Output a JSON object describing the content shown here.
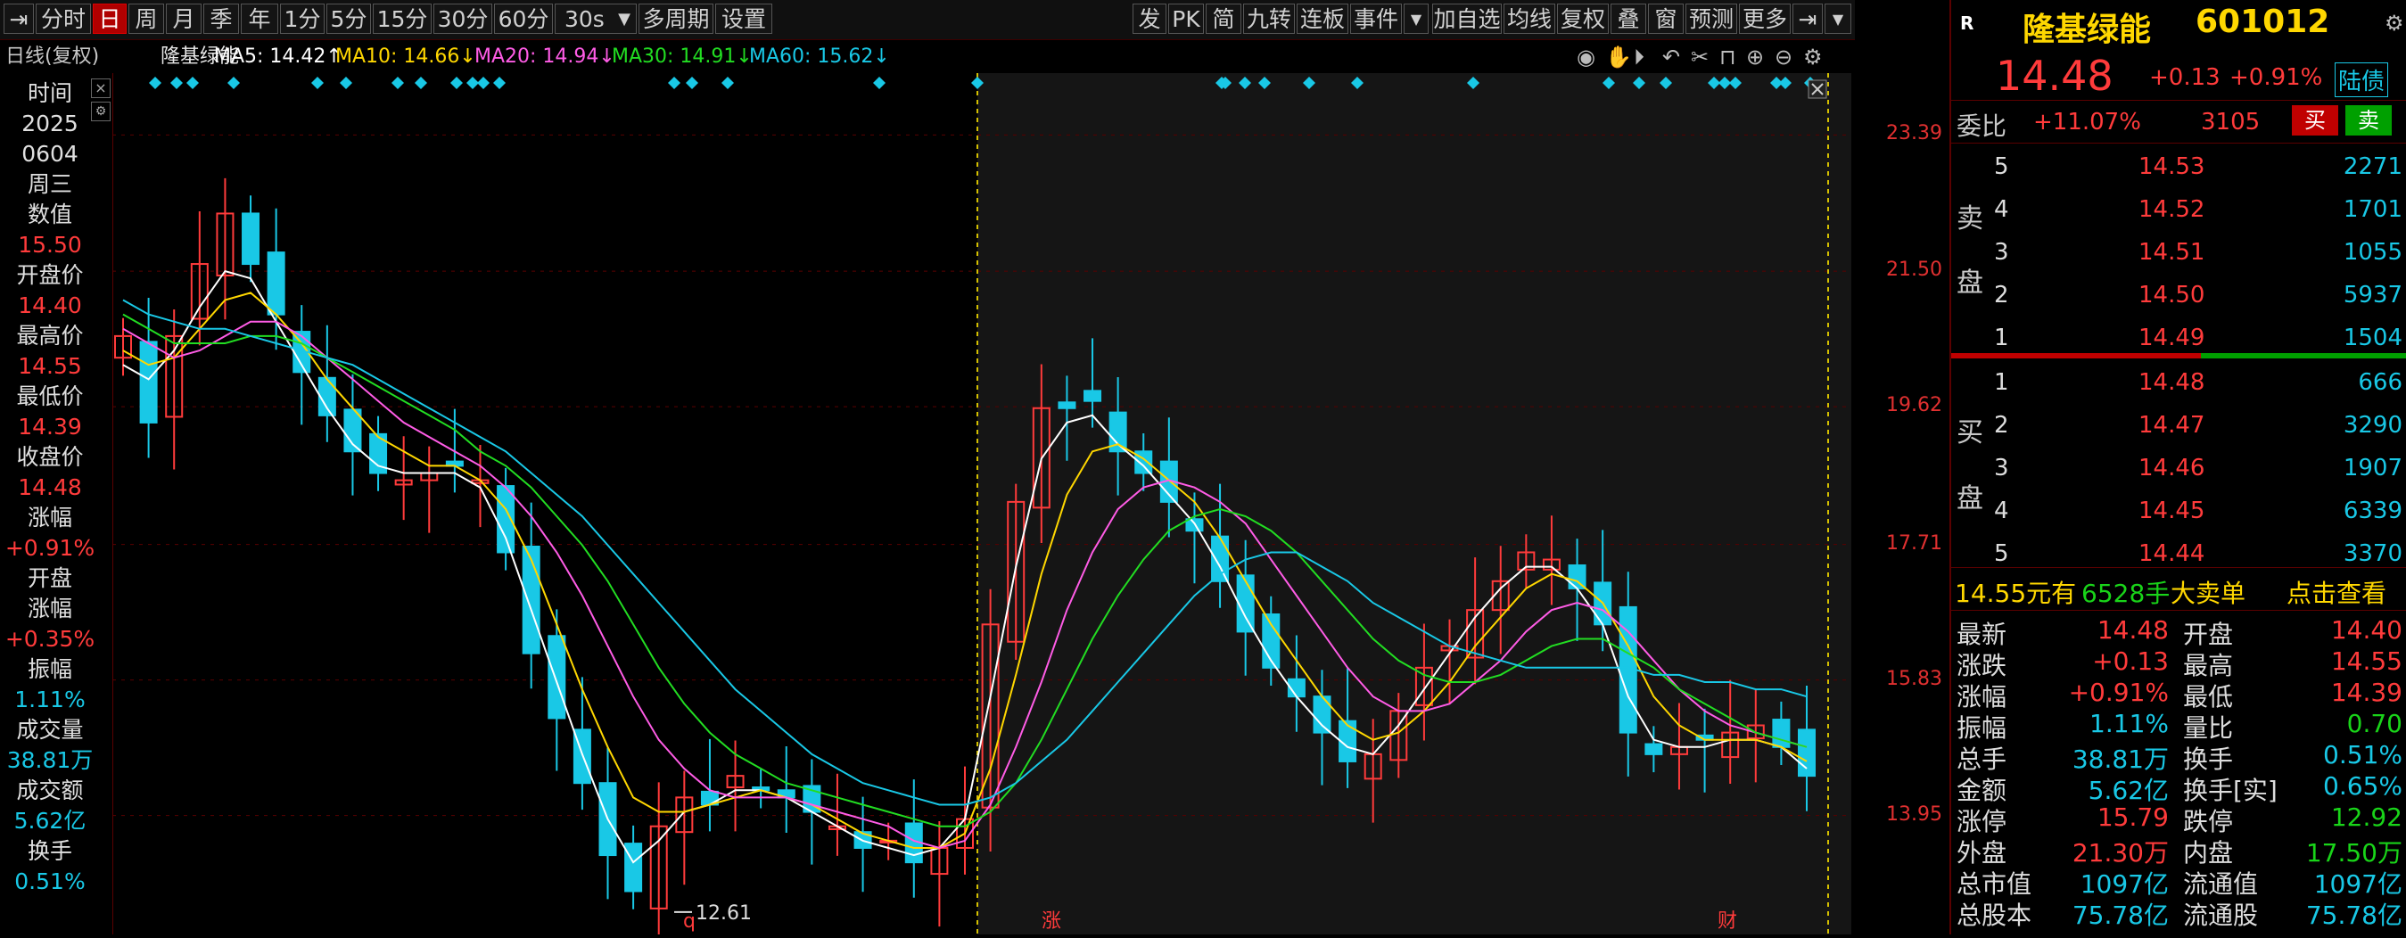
{
  "toolbar": {
    "left": [
      "分时",
      "日",
      "周",
      "月",
      "季",
      "年",
      "1分",
      "5分",
      "15分",
      "30分",
      "60分",
      "30s",
      "多周期",
      "设置"
    ],
    "right": [
      "发",
      "PK",
      "简",
      "九转",
      "连板",
      "事件",
      "加自选",
      "均线",
      "复权",
      "叠",
      "窗",
      "预测",
      "更多"
    ]
  },
  "ma_bar": {
    "mode": "日线(复权)",
    "name": "隆基绿能",
    "ma5": "MA5: 14.42↑",
    "ma10": "MA10: 14.66↓",
    "ma20": "MA20: 14.94↓",
    "ma30": "MA30: 14.91↓",
    "ma60": "MA60: 15.62↓"
  },
  "left_panel": {
    "time_label": "时间",
    "year": "2025",
    "date": "0604",
    "weekday": "周三",
    "value_label": "数值",
    "value": "15.50",
    "open_label": "开盘价",
    "open": "14.40",
    "high_label": "最高价",
    "high": "14.55",
    "low_label": "最低价",
    "low": "14.39",
    "close_label": "收盘价",
    "close": "14.48",
    "chg_label": "涨幅",
    "chg": "+0.91%",
    "openchg_label1": "开盘",
    "openchg_label2": "涨幅",
    "openchg": "+0.35%",
    "amp_label": "振幅",
    "amp": "1.11%",
    "vol_label": "成交量",
    "vol": "38.81万",
    "amt_label": "成交额",
    "amt": "5.62亿",
    "turn_label": "换手",
    "turn": "0.51%"
  },
  "y_axis": [
    "23.39",
    "21.50",
    "19.62",
    "17.71",
    "15.83",
    "13.95"
  ],
  "chart_marks": {
    "low_label": "12.61",
    "marker1": "q",
    "marker2": "涨",
    "marker3": "财"
  },
  "colors": {
    "up": "#ff3b3b",
    "down": "#19c8e6",
    "ma5": "#ffffff",
    "ma10": "#ffd700",
    "ma20": "#ff5ce6",
    "ma30": "#22dd22",
    "ma60": "#19c8e6"
  },
  "chart_data": {
    "type": "line",
    "title": "",
    "ylim": [
      12.3,
      24.0
    ],
    "y_ticks": [
      23.39,
      21.5,
      19.62,
      17.71,
      15.83,
      13.95
    ],
    "lows_label": 12.61,
    "close_path": [
      20.6,
      19.4,
      20.6,
      21.6,
      22.3,
      21.6,
      20.9,
      20.1,
      19.5,
      19.0,
      18.7,
      18.6,
      18.7,
      18.8,
      18.6,
      17.6,
      16.2,
      15.3,
      14.4,
      13.4,
      12.9,
      13.8,
      14.2,
      14.1,
      14.5,
      14.3,
      14.2,
      14.0,
      13.8,
      13.5,
      13.6,
      13.3,
      13.5,
      13.9,
      16.6,
      18.3,
      19.6,
      19.6,
      19.7,
      19.0,
      18.7,
      18.3,
      17.9,
      17.2,
      16.5,
      16.0,
      15.6,
      15.1,
      14.7,
      14.8,
      15.4,
      16.0,
      16.3,
      16.8,
      17.2,
      17.6,
      17.5,
      17.1,
      16.6,
      15.1,
      14.8,
      14.9,
      15.0,
      15.1,
      15.2,
      14.9,
      14.5
    ],
    "series": [
      {
        "name": "MA5",
        "values": [
          20.2,
          20.0,
          20.4,
          21.0,
          21.5,
          21.4,
          20.8,
          20.2,
          19.6,
          19.1,
          18.8,
          18.7,
          18.7,
          18.7,
          18.5,
          17.8,
          16.8,
          15.8,
          14.8,
          13.9,
          13.3,
          13.6,
          14.0,
          14.1,
          14.3,
          14.3,
          14.2,
          14.0,
          13.8,
          13.6,
          13.5,
          13.4,
          13.5,
          13.9,
          15.6,
          17.4,
          18.9,
          19.4,
          19.5,
          19.1,
          18.8,
          18.4,
          18.0,
          17.4,
          16.7,
          16.1,
          15.6,
          15.2,
          14.9,
          14.8,
          15.2,
          15.7,
          16.2,
          16.7,
          17.1,
          17.4,
          17.4,
          17.1,
          16.6,
          15.6,
          15.0,
          14.9,
          14.9,
          15.0,
          15.0,
          14.9,
          14.6
        ]
      },
      {
        "name": "MA10",
        "values": [
          20.4,
          20.2,
          20.3,
          20.7,
          21.1,
          21.2,
          20.9,
          20.5,
          20.0,
          19.6,
          19.2,
          19.0,
          18.8,
          18.8,
          18.6,
          18.2,
          17.5,
          16.6,
          15.7,
          14.9,
          14.2,
          14.0,
          14.0,
          14.1,
          14.2,
          14.3,
          14.2,
          14.1,
          13.9,
          13.7,
          13.6,
          13.5,
          13.5,
          13.7,
          14.6,
          15.9,
          17.3,
          18.4,
          19.0,
          19.1,
          18.9,
          18.6,
          18.3,
          17.8,
          17.2,
          16.6,
          16.1,
          15.6,
          15.2,
          15.0,
          15.1,
          15.4,
          15.8,
          16.3,
          16.7,
          17.1,
          17.3,
          17.2,
          16.9,
          16.3,
          15.6,
          15.2,
          15.0,
          15.0,
          15.0,
          14.9,
          14.7
        ]
      },
      {
        "name": "MA20",
        "values": [
          20.7,
          20.5,
          20.3,
          20.4,
          20.6,
          20.8,
          20.8,
          20.6,
          20.3,
          20.0,
          19.7,
          19.4,
          19.2,
          19.0,
          18.8,
          18.5,
          18.1,
          17.6,
          17.0,
          16.3,
          15.6,
          15.0,
          14.6,
          14.3,
          14.2,
          14.2,
          14.2,
          14.1,
          14.0,
          13.9,
          13.8,
          13.6,
          13.5,
          13.6,
          14.1,
          14.9,
          15.8,
          16.8,
          17.6,
          18.2,
          18.5,
          18.6,
          18.5,
          18.3,
          18.0,
          17.5,
          17.0,
          16.5,
          16.0,
          15.6,
          15.4,
          15.4,
          15.5,
          15.8,
          16.1,
          16.5,
          16.8,
          16.9,
          16.8,
          16.5,
          16.1,
          15.7,
          15.4,
          15.2,
          15.1,
          15.0,
          14.9
        ]
      },
      {
        "name": "MA30",
        "values": [
          20.9,
          20.7,
          20.5,
          20.5,
          20.5,
          20.6,
          20.6,
          20.5,
          20.3,
          20.1,
          19.9,
          19.7,
          19.5,
          19.3,
          19.0,
          18.8,
          18.5,
          18.1,
          17.7,
          17.2,
          16.6,
          16.0,
          15.5,
          15.1,
          14.8,
          14.6,
          14.4,
          14.3,
          14.2,
          14.1,
          14.0,
          13.9,
          13.8,
          13.8,
          14.0,
          14.4,
          15.0,
          15.7,
          16.4,
          17.0,
          17.5,
          17.9,
          18.1,
          18.2,
          18.1,
          17.9,
          17.6,
          17.2,
          16.8,
          16.4,
          16.1,
          15.9,
          15.8,
          15.8,
          15.9,
          16.1,
          16.3,
          16.4,
          16.4,
          16.2,
          16.0,
          15.7,
          15.5,
          15.3,
          15.1,
          15.0,
          14.9
        ]
      },
      {
        "name": "MA60",
        "values": [
          21.1,
          20.9,
          20.8,
          20.7,
          20.7,
          20.6,
          20.5,
          20.4,
          20.3,
          20.2,
          20.0,
          19.8,
          19.6,
          19.4,
          19.2,
          19.0,
          18.7,
          18.4,
          18.1,
          17.7,
          17.3,
          16.9,
          16.5,
          16.1,
          15.7,
          15.4,
          15.1,
          14.8,
          14.6,
          14.4,
          14.3,
          14.2,
          14.1,
          14.1,
          14.2,
          14.4,
          14.7,
          15.0,
          15.4,
          15.8,
          16.2,
          16.6,
          17.0,
          17.3,
          17.5,
          17.6,
          17.6,
          17.4,
          17.2,
          16.9,
          16.7,
          16.5,
          16.3,
          16.2,
          16.1,
          16.0,
          16.0,
          16.0,
          16.0,
          16.0,
          15.9,
          15.9,
          15.8,
          15.8,
          15.7,
          15.7,
          15.6
        ]
      }
    ]
  },
  "right_panel": {
    "logo": "R",
    "name": "隆基绿能",
    "code": "601012",
    "price": "14.48",
    "change": "+0.13",
    "pct": "+0.91%",
    "tag": "陆债",
    "weibi_label": "委比",
    "weibi": "+11.07%",
    "weicha": "3105",
    "buy_btn": "买",
    "sell_btn": "卖",
    "sell_label1": "卖",
    "sell_label2": "盘",
    "buy_label1": "买",
    "buy_label2": "盘",
    "asks": [
      {
        "lvl": "5",
        "price": "14.53",
        "vol": "2271"
      },
      {
        "lvl": "4",
        "price": "14.52",
        "vol": "1701"
      },
      {
        "lvl": "3",
        "price": "14.51",
        "vol": "1055"
      },
      {
        "lvl": "2",
        "price": "14.50",
        "vol": "5937"
      },
      {
        "lvl": "1",
        "price": "14.49",
        "vol": "1504"
      }
    ],
    "bids": [
      {
        "lvl": "1",
        "price": "14.48",
        "vol": "666"
      },
      {
        "lvl": "2",
        "price": "14.47",
        "vol": "3290"
      },
      {
        "lvl": "3",
        "price": "14.46",
        "vol": "1907"
      },
      {
        "lvl": "4",
        "price": "14.45",
        "vol": "6339"
      },
      {
        "lvl": "5",
        "price": "14.44",
        "vol": "3370"
      }
    ],
    "bigorder_price": "14.55元有",
    "bigorder_vol": "6528手",
    "bigorder_label": "大卖单",
    "bigorder_link": "点击查看",
    "stats": [
      [
        "最新",
        "14.48",
        "开盘",
        "14.40"
      ],
      [
        "涨跌",
        "+0.13",
        "最高",
        "14.55"
      ],
      [
        "涨幅",
        "+0.91%",
        "最低",
        "14.39"
      ],
      [
        "振幅",
        "1.11%",
        "量比",
        "0.70"
      ],
      [
        "总手",
        "38.81万",
        "换手",
        "0.51%"
      ],
      [
        "金额",
        "5.62亿",
        "换手[实]",
        "0.65%"
      ],
      [
        "涨停",
        "15.79",
        "跌停",
        "12.92"
      ],
      [
        "外盘",
        "21.30万",
        "内盘",
        "17.50万"
      ],
      [
        "总市值",
        "1097亿",
        "流通值",
        "1097亿"
      ],
      [
        "总股本",
        "75.78亿",
        "流通股",
        "75.78亿"
      ]
    ]
  }
}
